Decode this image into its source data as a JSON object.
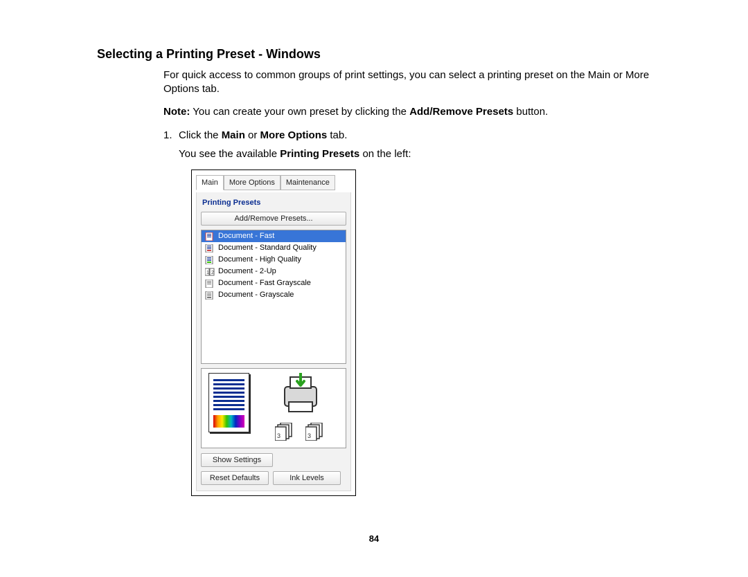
{
  "heading": "Selecting a Printing Preset - Windows",
  "intro": "For quick access to common groups of print settings, you can select a printing preset on the Main or More Options tab.",
  "note_label": "Note:",
  "note_body_a": " You can create your own preset by clicking the ",
  "note_bold": "Add/Remove Presets",
  "note_body_b": " button.",
  "step1_num": "1.",
  "step1_a": "Click the ",
  "step1_b1": "Main",
  "step1_mid": " or ",
  "step1_b2": "More Options",
  "step1_c": " tab.",
  "step1_cont_a": "You see the available ",
  "step1_cont_bold": "Printing Presets",
  "step1_cont_b": " on the left:",
  "page_number": "84",
  "shot": {
    "tabs": {
      "main": "Main",
      "more": "More Options",
      "maint": "Maintenance"
    },
    "section_title": "Printing Presets",
    "add_remove": "Add/Remove Presets...",
    "presets": [
      {
        "label": "Document - Fast",
        "selected": true
      },
      {
        "label": "Document - Standard Quality",
        "selected": false
      },
      {
        "label": "Document - High Quality",
        "selected": false
      },
      {
        "label": "Document - 2-Up",
        "selected": false
      },
      {
        "label": "Document - Fast Grayscale",
        "selected": false
      },
      {
        "label": "Document - Grayscale",
        "selected": false
      }
    ],
    "show_settings": "Show Settings",
    "reset_defaults": "Reset Defaults",
    "ink_levels": "Ink Levels"
  }
}
